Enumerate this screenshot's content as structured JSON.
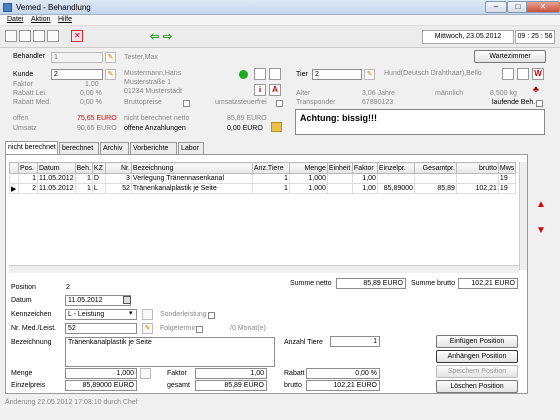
{
  "window": {
    "title": "Vemed - Behandlung",
    "min": "–",
    "max": "□",
    "close": "✕"
  },
  "menu": [
    "Datei",
    "Aktion",
    "Hilfe"
  ],
  "toolbar": {
    "back": "⇦",
    "forward": "⇨",
    "date": "Mittwoch, 23.05.2012",
    "time": "09 : 25 : 56"
  },
  "header": {
    "behandler_label": "Behandler",
    "behandler_value": "1",
    "behandler_name": "Tester,Max",
    "kunde_label": "Kunde",
    "kunde_value": "2",
    "kunde_name": "Mustermann,Hans",
    "kunde_street": "Musterstraße 1",
    "kunde_city": "01234 Musterstadt",
    "faktor_label": "Faktor",
    "faktor_value": "1,00",
    "rabatt_lei_label": "Rabatt Lei.",
    "rabatt_lei_value": "0,00 %",
    "rabatt_med_label": "Rabatt Med.",
    "rabatt_med_value": "0,00 %",
    "bruttopreise_label": "Bruttopreise",
    "umsatzsteuerfrei_label": "umsatzsteuerfrei",
    "wartezimmer_label": "Wartezimmer",
    "tier_label": "Tier",
    "tier_value": "2",
    "tier_name": "Hund(Deutsch Drahthaar),Bello",
    "alter_label": "Alter",
    "alter_value": "3,06 Jahre",
    "geschlecht": "männlich",
    "gewicht": "8,500 kg",
    "transponder_label": "Transponder",
    "transponder_value": "67890123",
    "laufende_label": "laufende Beh.",
    "offen_label": "offen",
    "offen_value": "75,65 EURO",
    "umsatz_label": "Umsatz",
    "umsatz_value": "90,65 EURO",
    "nicht_netto_label": "nicht berechnet netto",
    "nicht_netto_value": "85,89 EURO",
    "anzahlungen_label": "offene Anzahlungen",
    "anzahlungen_value": "0,00 EURO",
    "warning": "Achtung: bissig!!!",
    "icon_i": "i",
    "icon_a": "A",
    "icon_w": "W"
  },
  "tabs": [
    "nicht berechnet",
    "berechnet",
    "Archiv",
    "Vorberichte",
    "Labor"
  ],
  "table": {
    "columns": [
      "Pos.",
      "Datum",
      "Beh.",
      "KZ",
      "Nr.",
      "Bezeichnung",
      "Anz.Tiere",
      "Menge",
      "Einheit",
      "Faktor",
      "Einzelpr.",
      "Gesamtpr.",
      "brutto",
      "Mws"
    ],
    "rows": [
      {
        "marker": "",
        "pos": "1",
        "datum": "11.05.2012",
        "beh": "1",
        "kz": "D",
        "nr": "3",
        "bez": "Verlegung Tränennasenkanal",
        "anz": "1",
        "menge": "1,000",
        "einheit": "",
        "faktor": "1,00",
        "einzel": "",
        "gesamt": "",
        "brutto": "",
        "mws": "19"
      },
      {
        "marker": "▶",
        "pos": "2",
        "datum": "11.05.2012",
        "beh": "1",
        "kz": "L",
        "nr": "52",
        "bez": "Tränenkanalplastik je Seite",
        "anz": "1",
        "menge": "1,000",
        "einheit": "",
        "faktor": "1,00",
        "einzel": "85,89000",
        "gesamt": "85,89",
        "brutto": "102,21",
        "mws": "19"
      }
    ]
  },
  "summary": {
    "netto_label": "Summe netto",
    "netto_value": "85,89 EURO",
    "brutto_label": "Summe brutto",
    "brutto_value": "102,21 EURO"
  },
  "detail": {
    "position_label": "Position",
    "position_value": "2",
    "datum_label": "Datum",
    "datum_value": "11.05.2012",
    "kennzeichen_label": "Kennzeichen",
    "kennzeichen_value": "L - Leistung",
    "sonderleistung_label": "Sonderleistung",
    "nr_label": "Nr. Med./Leist.",
    "nr_value": "52",
    "folgetermin_label": "Folgetermin",
    "monat_label": "/0 Monat(e)",
    "bezeichnung_label": "Bezeichnung",
    "bezeichnung_value": "Tränenkanalplastik je Seite",
    "anzahl_label": "Anzahl Tiere",
    "anzahl_value": "1",
    "menge_label": "Menge",
    "menge_value": "1,000",
    "faktor_label": "Faktor",
    "faktor_value": "1,00",
    "rabatt_label": "Rabatt",
    "rabatt_value": "0,00 %",
    "einzelpreis_label": "Einzelpreis",
    "einzelpreis_value": "85,89000 EURO",
    "gesamt_label": "gesamt",
    "gesamt_value": "85,89 EURO",
    "brutto_label": "brutto",
    "brutto_value": "102,21 EURO"
  },
  "buttons": {
    "einfuegen": "Einfügen Position",
    "anhaengen": "Anhängen Position",
    "speichern": "Speichern Position",
    "loeschen": "Löschen Position"
  },
  "status": "Änderung 22.05.2012 17:03:10 durch  Chef",
  "colors": {
    "offen": "#dd0000",
    "arrows": "#dd0000",
    "status_dot": "#22aa22"
  }
}
